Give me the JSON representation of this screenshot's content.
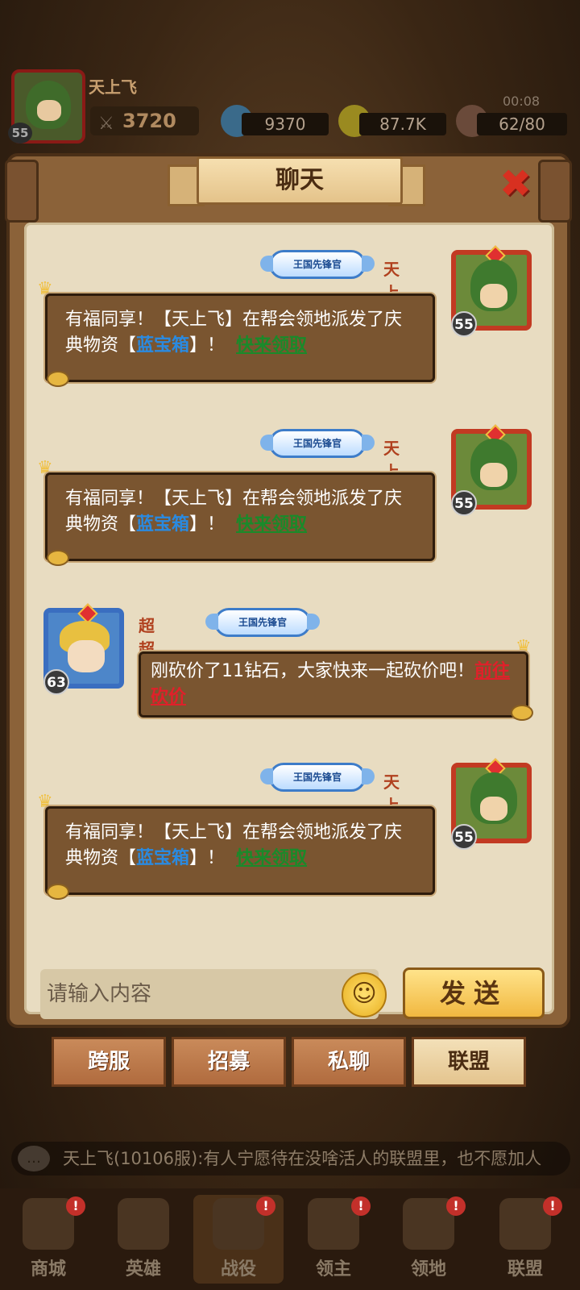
{
  "hud": {
    "player_name": "天上飞",
    "player_level": "55",
    "power": "3720",
    "gems": "9370",
    "gold": "87.7K",
    "stamina": "62/80",
    "timer": "00:08"
  },
  "chat": {
    "title": "聊天",
    "messages": [
      {
        "sender": "天上飞",
        "level": "55",
        "rank": "王国先锋官",
        "text_a": "有福同享！【天上飞】在帮会领地派发了庆典物资【",
        "item": "蓝宝箱",
        "text_b": "】！",
        "link": "快来领取"
      },
      {
        "sender": "天上飞",
        "level": "55",
        "rank": "王国先锋官",
        "text_a": "有福同享！【天上飞】在帮会领地派发了庆典物资【",
        "item": "蓝宝箱",
        "text_b": "】！",
        "link": "快来领取"
      },
      {
        "sender": "超超超",
        "level": "63",
        "rank": "王国先锋官",
        "text_a": "刚砍价了11钻石，大家快来一起砍价吧！",
        "link": "前往砍价"
      },
      {
        "sender": "天上飞",
        "level": "55",
        "rank": "王国先锋官",
        "text_a": "有福同享！【天上飞】在帮会领地派发了庆典物资【",
        "item": "蓝宝箱",
        "text_b": "】！",
        "link": "快来领取"
      }
    ],
    "input_placeholder": "请输入内容",
    "send_label": "发送",
    "tabs": [
      "跨服",
      "招募",
      "私聊",
      "联盟"
    ],
    "active_tab": "联盟"
  },
  "ticker": {
    "text": "天上飞(10106服):有人宁愿待在没啥活人的联盟里，也不愿加人"
  },
  "bottom_nav": [
    "商城",
    "英雄",
    "战役",
    "领主",
    "领地",
    "联盟"
  ],
  "colors": {
    "panel": "#8b6239",
    "paper": "#e8dcc1",
    "bubble": "#7a5530",
    "item_blue": "#2a8ae0",
    "link_green": "#1a8a2a",
    "link_red": "#e0202a",
    "sender": "#b0401e"
  },
  "icons": [
    "close-icon",
    "emoji-icon",
    "crown-icon",
    "coin-icon",
    "gem-icon",
    "gold-icon",
    "stamina-icon",
    "sword-icon",
    "speaker-icon"
  ]
}
